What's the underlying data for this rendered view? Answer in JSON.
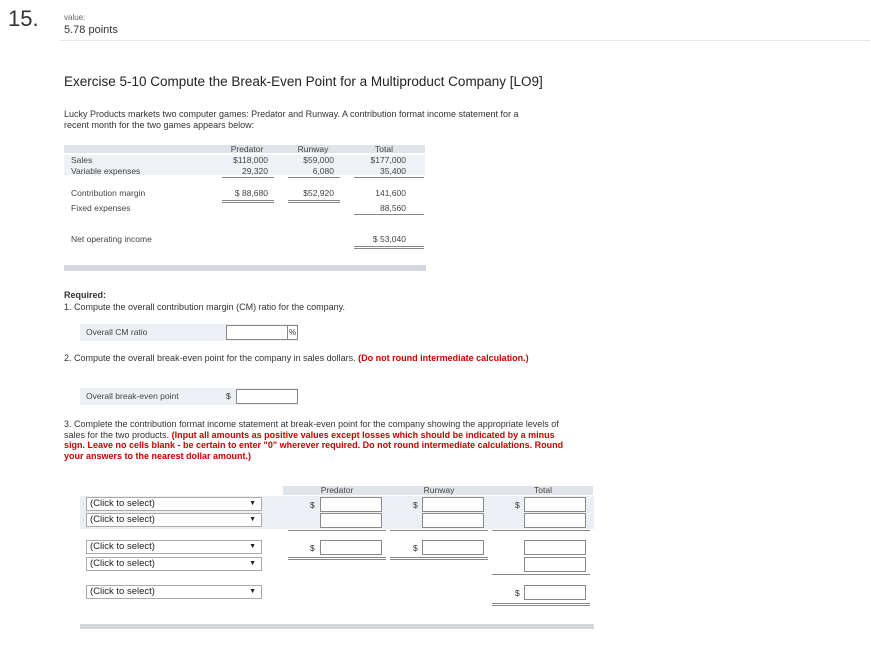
{
  "question": {
    "number": "15.",
    "value_label": "value:",
    "points": "5.78 points"
  },
  "exercise_title": "Exercise 5-10 Compute the Break-Even Point for a Multiproduct Company [LO9]",
  "intro_text": "Lucky Products markets two computer games: Predator and Runway. A contribution format income statement for a recent month for the two games appears below:",
  "statement": {
    "headers": [
      "Predator",
      "Runway",
      "Total"
    ],
    "rows": [
      {
        "label": "Sales",
        "values": [
          "$118,000",
          "$59,000",
          "$177,000"
        ]
      },
      {
        "label": "Variable expenses",
        "values": [
          "29,320",
          "6,080",
          "35,400"
        ]
      },
      {
        "label": "Contribution margin",
        "values": [
          "$ 88,680",
          "$52,920",
          "141,600"
        ]
      },
      {
        "label": "Fixed expenses",
        "values": [
          "",
          "",
          "88,560"
        ]
      },
      {
        "label": "Net operating income",
        "values": [
          "",
          "",
          "$ 53,040"
        ]
      }
    ]
  },
  "required": {
    "heading": "Required:",
    "q1": "1.  Compute the overall contribution margin (CM) ratio for the company.",
    "cm_label": "Overall CM ratio",
    "cm_value": "",
    "cm_unit": "%",
    "q2_text": "2.  Compute the overall break-even point for the company in sales dollars.",
    "q2_note": "(Do not round intermediate calculation.)",
    "be_label": "Overall break-even point",
    "be_currency": "$",
    "be_value": "",
    "q3_text": "3.  Complete the contribution format income statement at break-even point for the company showing the appropriate levels of sales for the two products.",
    "q3_note": "(Input all amounts as positive values except losses which should be indicated by a minus sign. Leave no cells blank - be certain to enter \"0\" wherever required. Do not round intermediate calculations. Round your answers to the nearest dollar amount.)"
  },
  "be_statement": {
    "headers": [
      "Predator",
      "Runway",
      "Total"
    ],
    "select_placeholder": "(Click to select)",
    "currency": "$"
  }
}
